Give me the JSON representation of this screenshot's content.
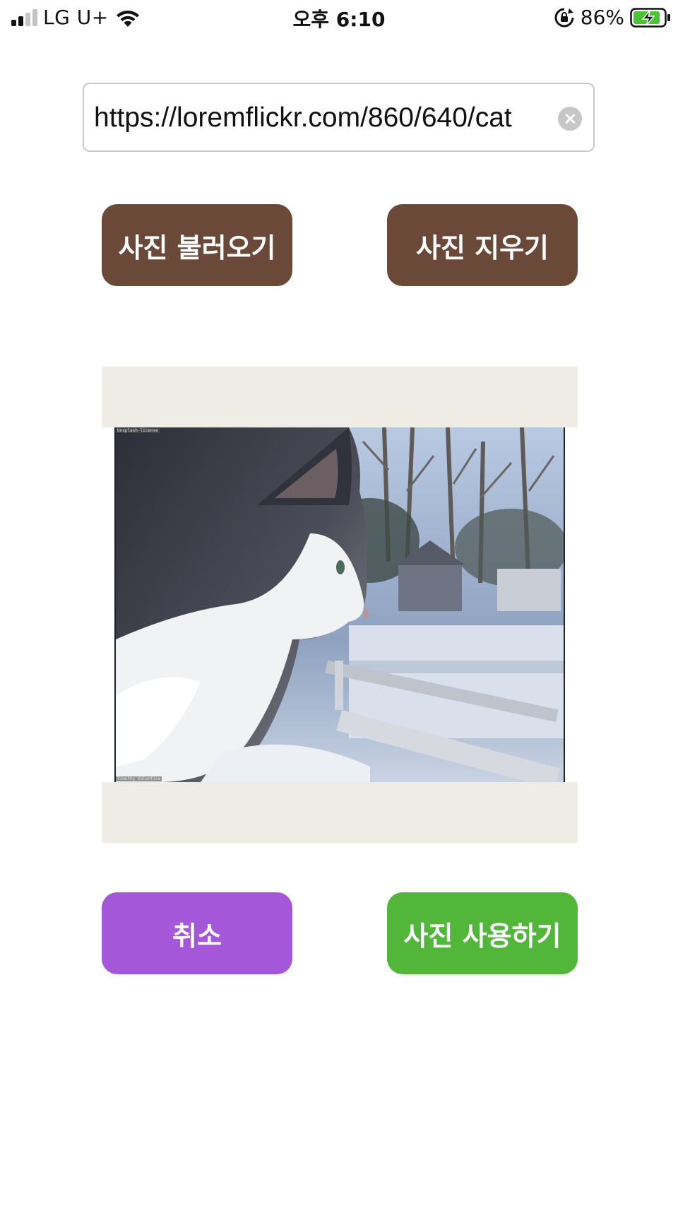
{
  "status_bar": {
    "carrier": "LG U+",
    "time": "오후 6:10",
    "battery_percent": "86%",
    "battery_level": 0.86,
    "signal_bars": 2,
    "signal_bars_total": 4,
    "icons": [
      "signal-icon",
      "wifi-icon",
      "lock-rotation-icon",
      "battery-charging-icon"
    ]
  },
  "url_input": {
    "value": "https://loremflickr.com/860/640/cat",
    "clear_icon": "clear-icon"
  },
  "buttons": {
    "load": "사진 불러오기",
    "delete": "사진 지우기",
    "cancel": "취소",
    "use": "사진 사용하기"
  },
  "preview": {
    "alt": "cat looking out of a window",
    "credit_top": "Unsplash-license",
    "credit_bottom": "Timothy Valentine"
  },
  "colors": {
    "brown_button": "#6b4939",
    "purple_button": "#a457d8",
    "green_button": "#52b63b",
    "preview_background": "#efebe5"
  }
}
